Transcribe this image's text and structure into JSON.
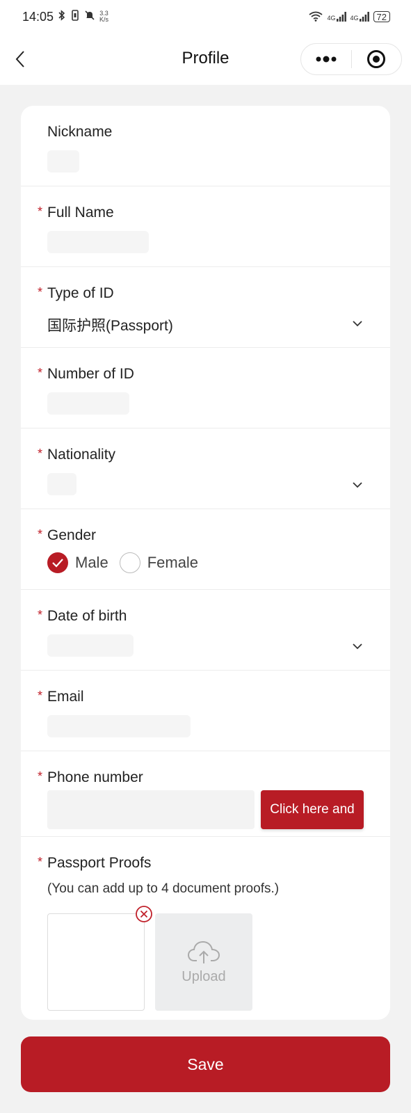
{
  "status_bar": {
    "time": "14:05",
    "speed_value": "3.3",
    "speed_unit": "K/s",
    "net_1": "4G",
    "net_2": "4G",
    "battery": "72"
  },
  "navbar": {
    "title": "Profile"
  },
  "form": {
    "nickname": {
      "label": "Nickname"
    },
    "full_name": {
      "label": "Full Name"
    },
    "id_type": {
      "label": "Type of ID",
      "value": "国际护照(Passport)"
    },
    "id_number": {
      "label": "Number of ID"
    },
    "nationality": {
      "label": "Nationality"
    },
    "gender": {
      "label": "Gender",
      "options": [
        "Male",
        "Female"
      ],
      "selected": "Male"
    },
    "birth": {
      "label": "Date of birth"
    },
    "email": {
      "label": "Email"
    },
    "phone": {
      "label": "Phone number",
      "code_button": "Click here and"
    },
    "proofs": {
      "label": "Passport Proofs",
      "hint": "(You can add up to 4 document proofs.)",
      "upload_label": "Upload"
    },
    "required_mark": "*"
  },
  "save_label": "Save",
  "colors": {
    "accent": "#b81c25",
    "required": "#c0202a"
  },
  "icons": [
    "back-arrow-icon",
    "more-dots-icon",
    "target-icon",
    "chevron-down-icon",
    "check-icon",
    "close-circle-icon",
    "cloud-upload-icon"
  ]
}
